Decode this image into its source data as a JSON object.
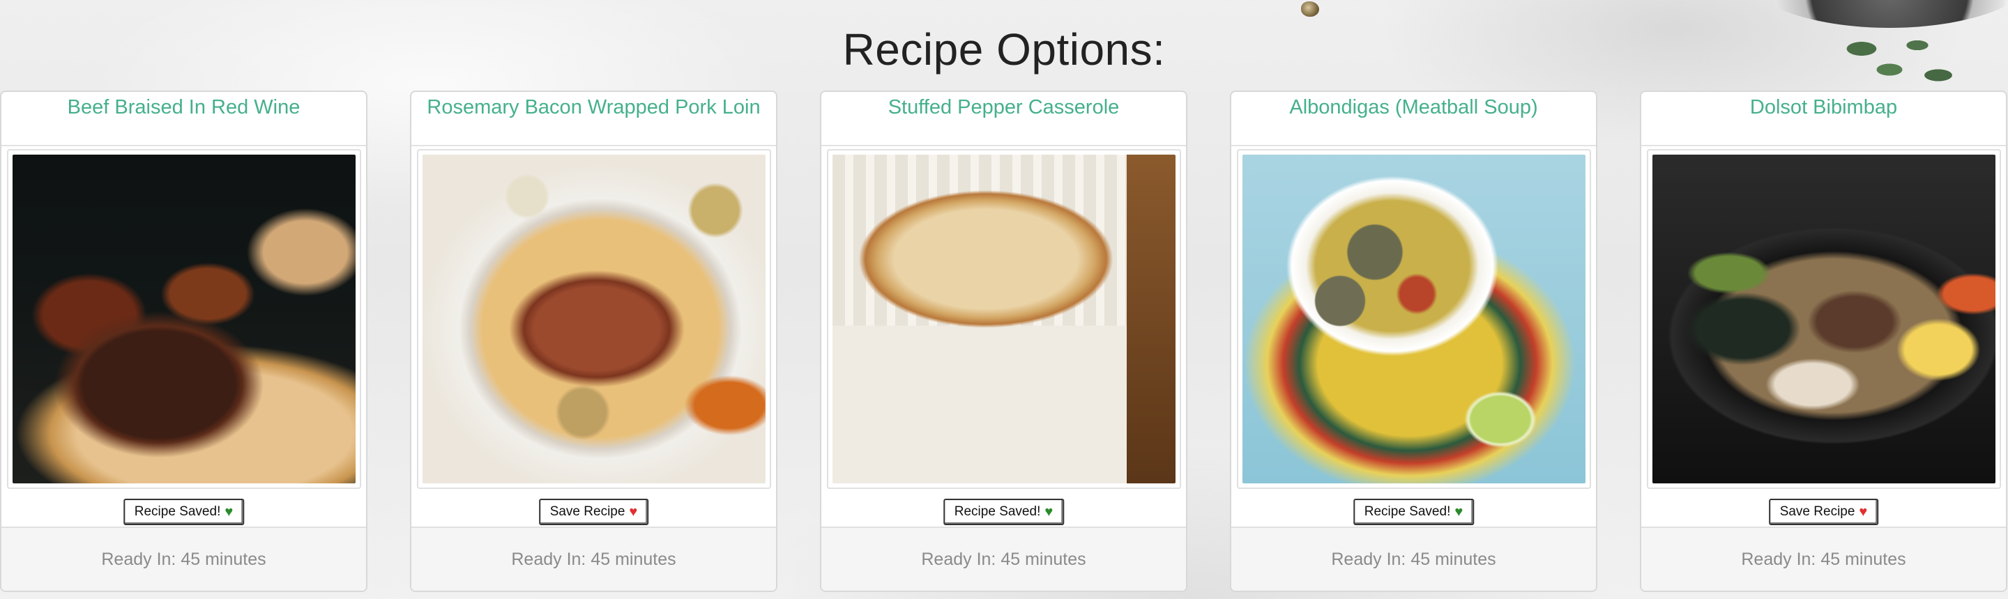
{
  "page": {
    "title": "Recipe Options:"
  },
  "recipes": [
    {
      "title": "Beef Braised In Red Wine",
      "image": "beef-braised-photo",
      "button_label": "Recipe Saved!",
      "saved": true,
      "ready_in": "Ready In: 45 minutes"
    },
    {
      "title": "Rosemary Bacon Wrapped Pork Loin",
      "image": "pork-loin-photo",
      "button_label": "Save Recipe",
      "saved": false,
      "ready_in": "Ready In: 45 minutes"
    },
    {
      "title": "Stuffed Pepper Casserole",
      "image": "casserole-photo",
      "button_label": "Recipe Saved!",
      "saved": true,
      "ready_in": "Ready In: 45 minutes"
    },
    {
      "title": "Albondigas (Meatball Soup)",
      "image": "meatball-soup-photo",
      "button_label": "Recipe Saved!",
      "saved": true,
      "ready_in": "Ready In: 45 minutes"
    },
    {
      "title": "Dolsot Bibimbap",
      "image": "bibimbap-photo",
      "button_label": "Save Recipe",
      "saved": false,
      "ready_in": "Ready In: 45 minutes"
    }
  ],
  "colors": {
    "title_accent": "#45b08c",
    "saved_heart": "#2a8a2a",
    "unsaved_heart": "#e0302f",
    "footer_text": "#8a8a8a"
  },
  "icons": {
    "saved": "green-heart-icon",
    "unsaved": "red-heart-icon"
  }
}
